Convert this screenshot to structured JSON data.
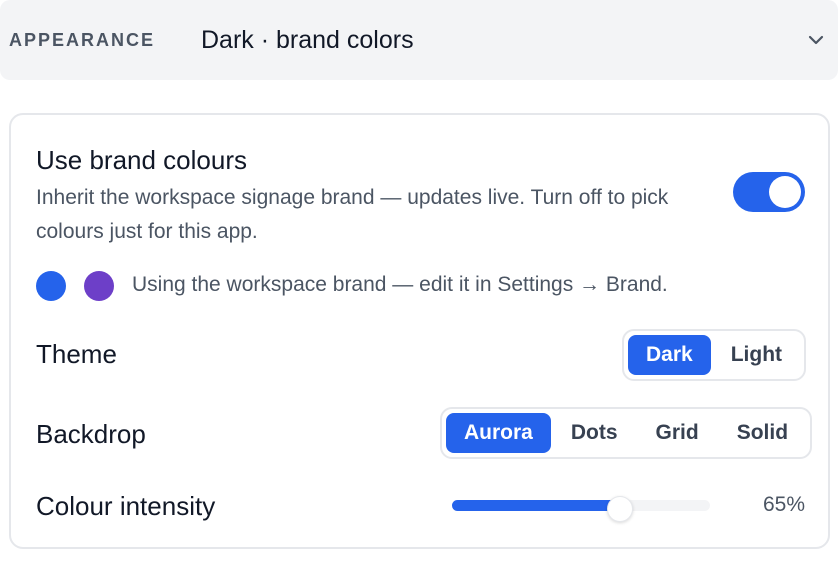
{
  "header": {
    "label": "APPEARANCE",
    "value": "Dark · brand colors",
    "expand_icon": "chevron-down-icon"
  },
  "brand": {
    "title": "Use brand colours",
    "description": "Inherit the workspace signage brand — updates live. Turn off to pick colours just for this app.",
    "enabled": true,
    "swatches": [
      "#2563eb",
      "#6d3fc8"
    ],
    "note": "Using the workspace brand — edit it in Settings → Brand."
  },
  "theme": {
    "label": "Theme",
    "options": [
      "Dark",
      "Light"
    ],
    "selected": "Dark"
  },
  "backdrop": {
    "label": "Backdrop",
    "options": [
      "Aurora",
      "Dots",
      "Grid",
      "Solid"
    ],
    "selected": "Aurora"
  },
  "intensity": {
    "label": "Colour intensity",
    "value_percent": 65,
    "value_label": "65%"
  },
  "colors": {
    "accent": "#2563eb",
    "header_bg": "#f3f4f6",
    "border": "#e5e7eb"
  }
}
